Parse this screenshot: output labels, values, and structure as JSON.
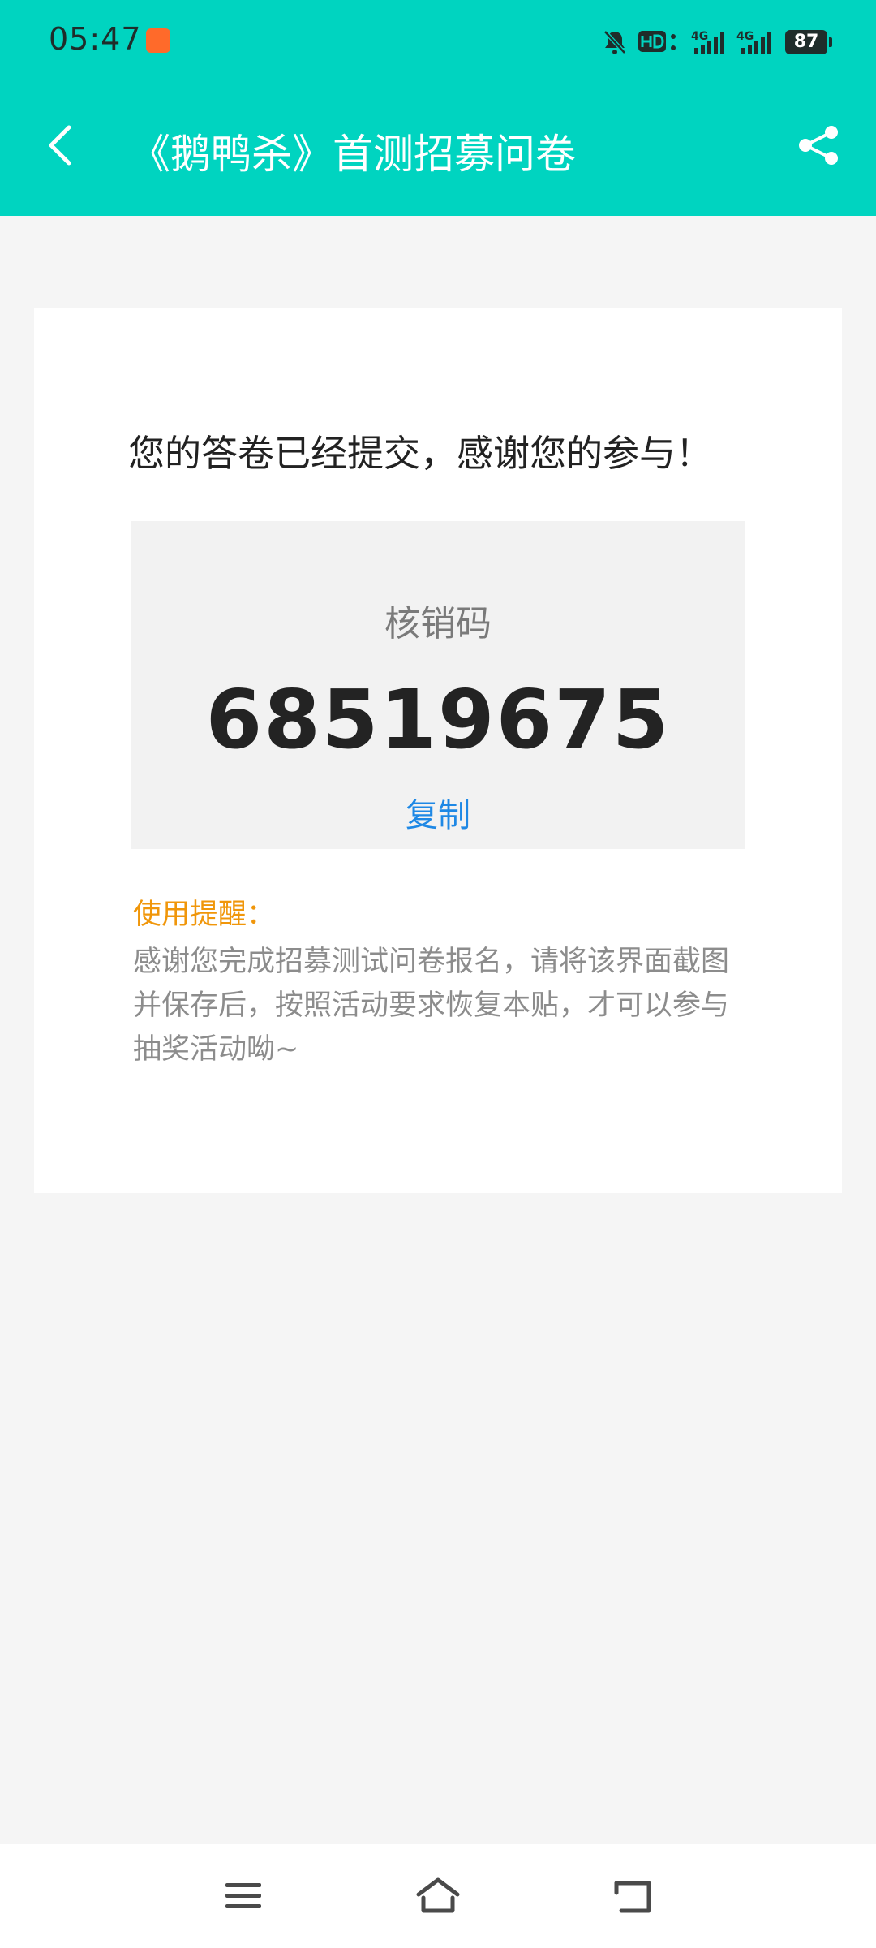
{
  "status_bar": {
    "time": "05:47",
    "battery": "87"
  },
  "app_bar": {
    "title": "《鹅鸭杀》首测招募问卷"
  },
  "card": {
    "headline": "您的答卷已经提交，感谢您的参与！",
    "code_label": "核销码",
    "code_value": "68519675",
    "copy_label": "复制",
    "reminder_title": "使用提醒：",
    "reminder_text": "感谢您完成招募测试问卷报名，请将该界面截图并保存后，按照活动要求恢复本贴，才可以参与抽奖活动呦~"
  },
  "colors": {
    "header_bg": "#00d4c0",
    "page_bg": "#f5f5f5",
    "code_box_bg": "#f2f2f2",
    "link": "#1e88e5",
    "reminder_title": "#f0960a",
    "reminder_text": "#8c8c8c"
  },
  "icons": {
    "back": "chevron-left-icon",
    "share": "share-icon",
    "menu": "menu-icon",
    "home": "home-icon",
    "return": "return-icon"
  }
}
